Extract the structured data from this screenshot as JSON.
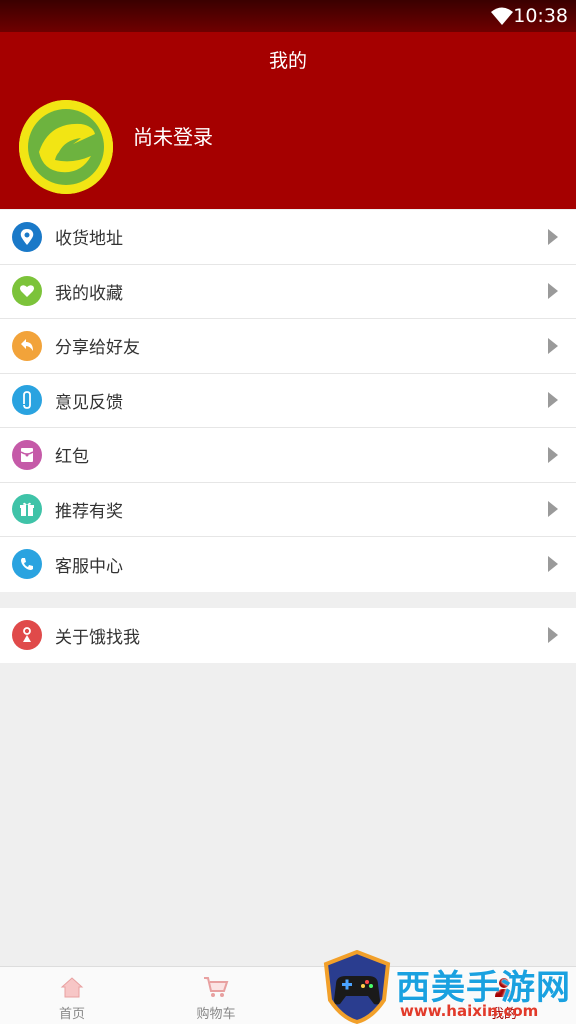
{
  "status_bar": {
    "time": "10:38"
  },
  "header": {
    "title": "我的",
    "login_text": "尚未登录"
  },
  "menu_group_1": [
    {
      "label": "收货地址",
      "icon": "location-icon",
      "color": "#1a79c8"
    },
    {
      "label": "我的收藏",
      "icon": "heart-icon",
      "color": "#7cc33a"
    },
    {
      "label": "分享给好友",
      "icon": "share-icon",
      "color": "#f2a33a"
    },
    {
      "label": "意见反馈",
      "icon": "paperclip-icon",
      "color": "#2aa3e0"
    },
    {
      "label": "红包",
      "icon": "red-packet-icon",
      "color": "#c55aa8"
    },
    {
      "label": "推荐有奖",
      "icon": "gift-icon",
      "color": "#3fc3a8"
    },
    {
      "label": "客服中心",
      "icon": "phone-icon",
      "color": "#2aa3e0"
    }
  ],
  "menu_group_2": [
    {
      "label": "关于饿找我",
      "icon": "about-icon",
      "color": "#e04a4a"
    }
  ],
  "tabbar": {
    "tabs": [
      {
        "label": "首页",
        "icon": "home-icon"
      },
      {
        "label": "购物车",
        "icon": "cart-icon"
      },
      {
        "label": "我的",
        "icon": "user-icon"
      }
    ]
  },
  "watermark": {
    "text": "西美手游网",
    "url": "www.haixin.com"
  },
  "colors": {
    "header_bg": "#a50000",
    "page_bg": "#efefef"
  }
}
